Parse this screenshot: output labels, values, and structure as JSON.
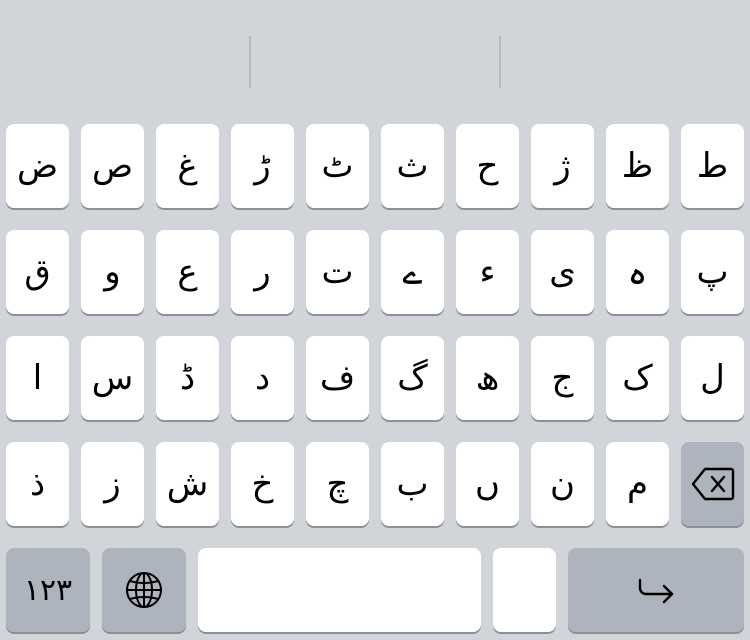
{
  "suggestion_bar": {
    "slots": [
      "",
      "",
      ""
    ]
  },
  "rows": [
    [
      "ط",
      "ظ",
      "ژ",
      "ح",
      "ث",
      "ٹ",
      "ڑ",
      "غ",
      "ص",
      "ض"
    ],
    [
      "پ",
      "ہ",
      "ی",
      "ء",
      "ے",
      "ت",
      "ر",
      "ع",
      "و",
      "ق"
    ],
    [
      "ل",
      "ک",
      "ج",
      "ھ",
      "گ",
      "ف",
      "د",
      "ڈ",
      "س",
      "ا"
    ],
    [
      "م",
      "ن",
      "ں",
      "ب",
      "چ",
      "خ",
      "ش",
      "ز",
      "ذ"
    ]
  ],
  "bottom_row": {
    "numbers_label": "۱۲۳",
    "space_label": "",
    "small_key_label": ""
  },
  "icons": {
    "delete": "delete-icon",
    "globe": "globe-icon",
    "return": "return-icon"
  },
  "colors": {
    "keyboard_background": "#d1d4d9",
    "key_background": "#ffffff",
    "special_key_background": "#adb4bd",
    "key_shadow": "#8c9097"
  }
}
